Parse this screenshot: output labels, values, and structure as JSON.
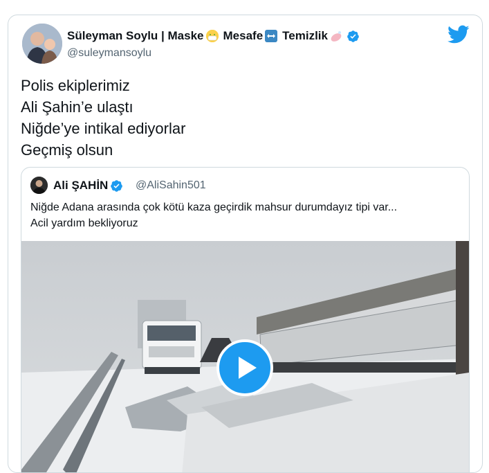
{
  "tweet": {
    "author_name": "Süleyman Soylu | Maske",
    "name_part2": "Mesafe",
    "name_part3": "Temizlik",
    "handle": "@suleymansoylu",
    "text_lines": [
      "Polis ekiplerimiz",
      "Ali Şahin’e ulaştı",
      "Niğde’ye intikal ediyorlar",
      "Geçmiş olsun"
    ],
    "icons": [
      "mask-emoji-icon",
      "left-right-arrow-emoji-icon",
      "soap-emoji-icon",
      "verified-badge-icon",
      "twitter-bird-icon"
    ]
  },
  "quoted": {
    "author_name": "Ali ŞAHİN",
    "handle": "@AliSahin501",
    "text_lines": [
      "Niğde Adana arasında çok kötü kaza geçirdik mahsur durumdayız tipi var...",
      "Acil yardım bekliyoruz"
    ],
    "media_type": "video",
    "media_description_icon": "play-icon"
  },
  "colors": {
    "accent": "#1d9bf0",
    "text": "#0f1419",
    "secondary": "#536471",
    "border": "#cfd9de"
  }
}
